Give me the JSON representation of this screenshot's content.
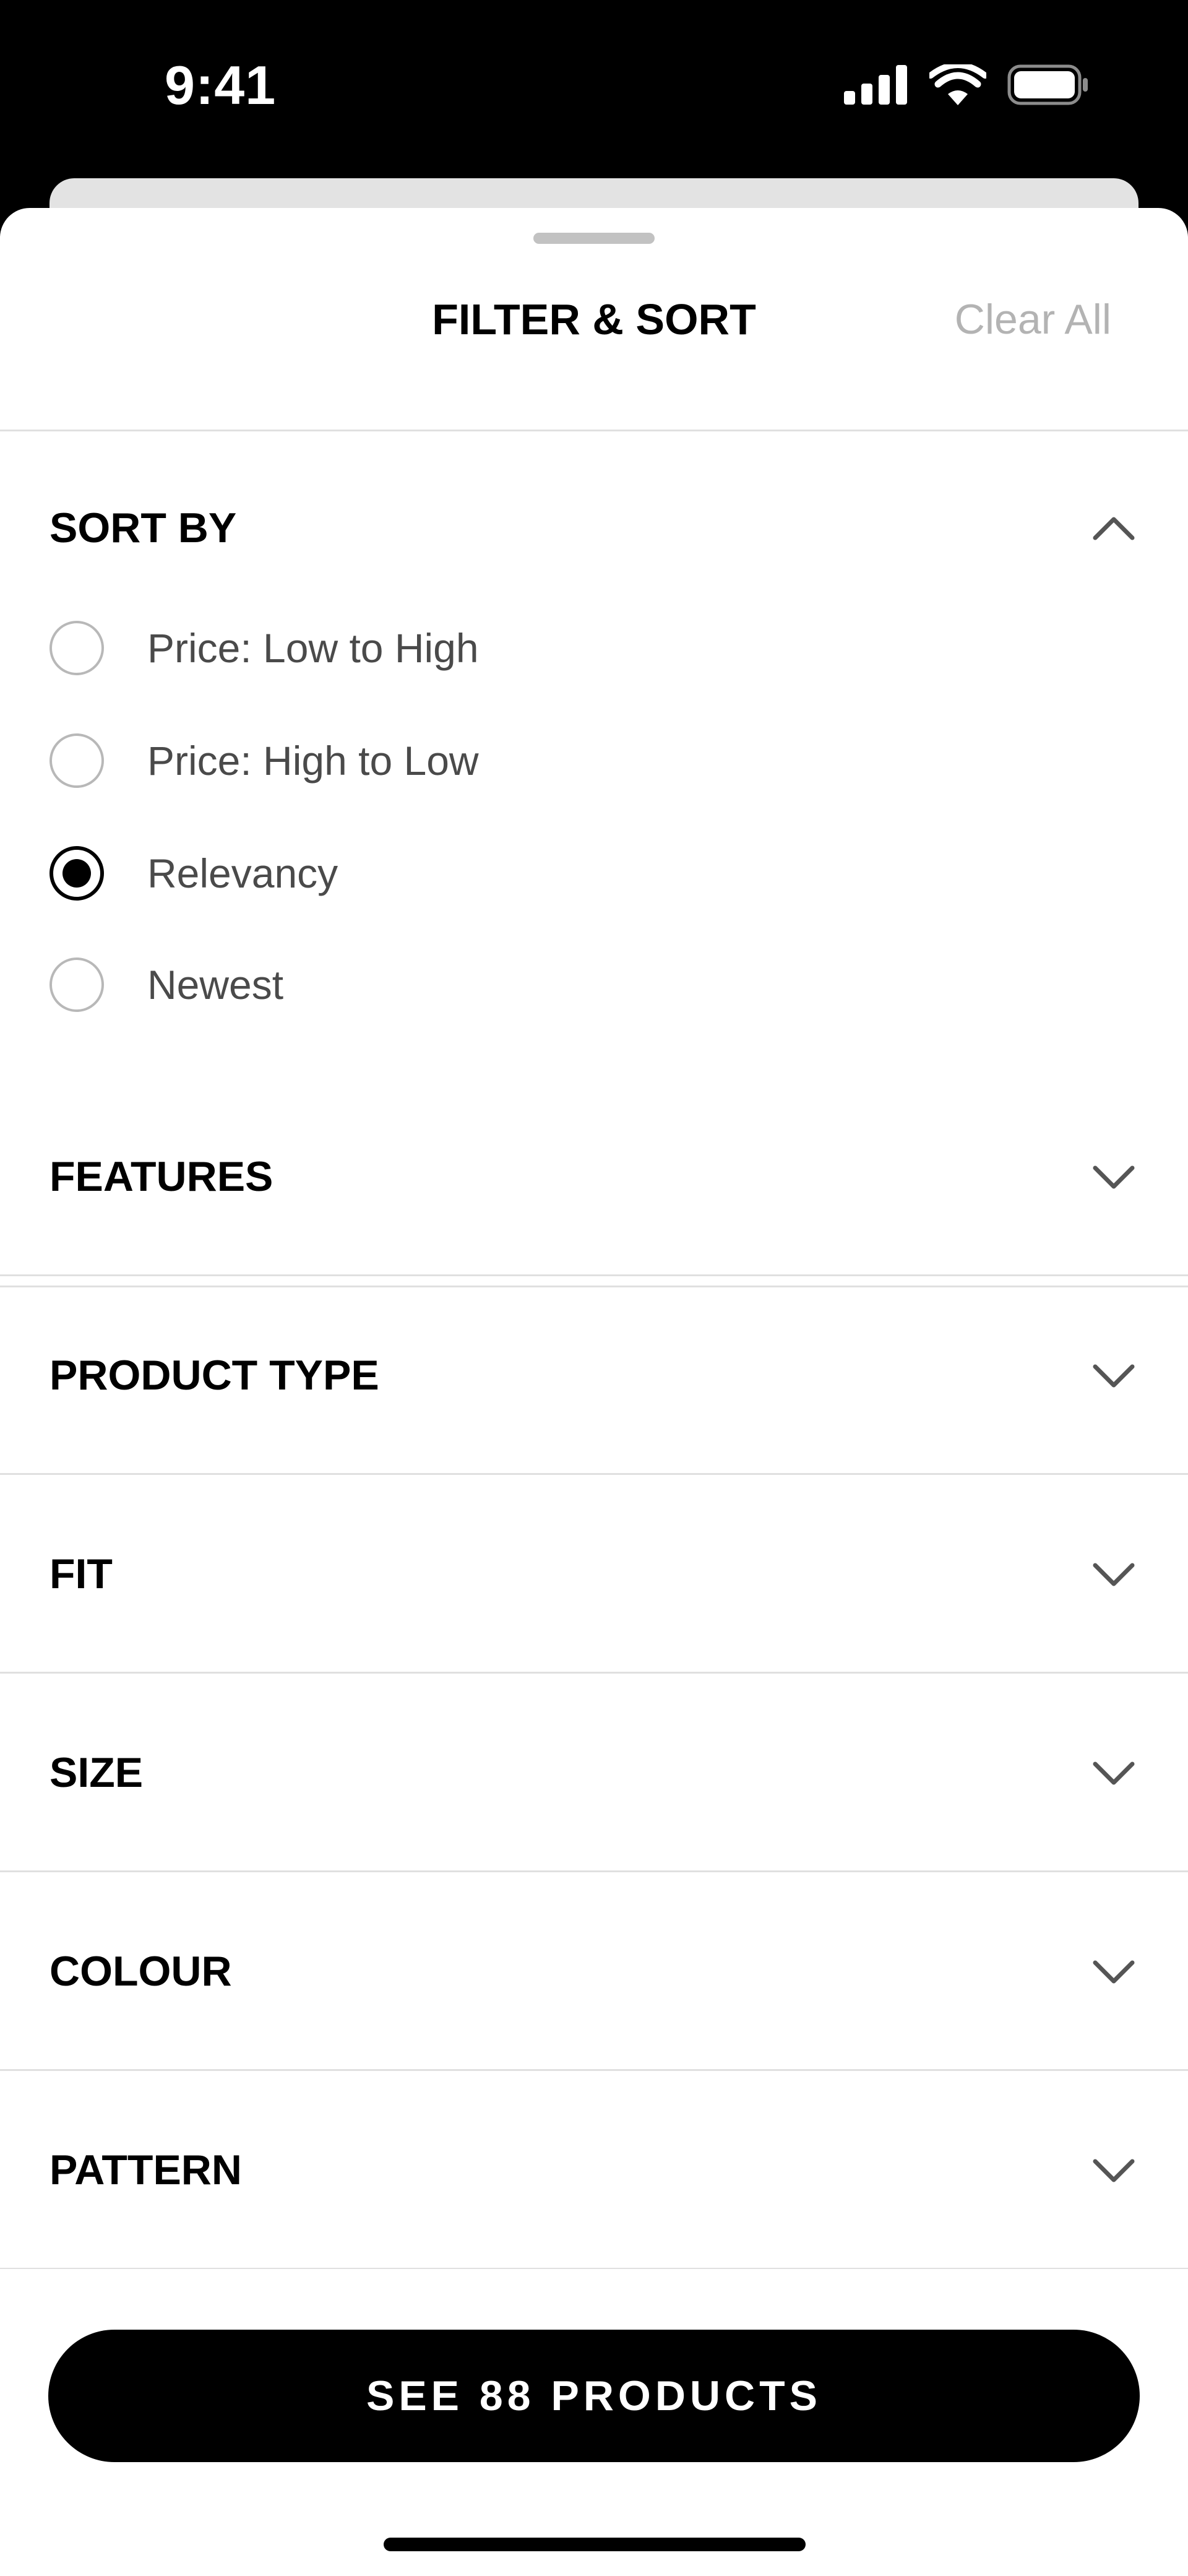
{
  "status_bar": {
    "time": "9:41",
    "icons": [
      "cellular-signal-icon",
      "wifi-icon",
      "battery-icon"
    ]
  },
  "sheet": {
    "title": "FILTER & SORT",
    "clear_all_label": "Clear All"
  },
  "sort_by": {
    "title": "SORT BY",
    "expanded": true,
    "options": [
      {
        "label": "Price: Low to High",
        "selected": false
      },
      {
        "label": "Price: High to Low",
        "selected": false
      },
      {
        "label": "Relevancy",
        "selected": true
      },
      {
        "label": "Newest",
        "selected": false
      }
    ]
  },
  "filters": [
    {
      "title": "FEATURES",
      "expanded": false
    },
    {
      "title": "PRODUCT TYPE",
      "expanded": false
    },
    {
      "title": "FIT",
      "expanded": false
    },
    {
      "title": "SIZE",
      "expanded": false
    },
    {
      "title": "COLOUR",
      "expanded": false
    },
    {
      "title": "PATTERN",
      "expanded": false
    }
  ],
  "footer": {
    "cta_label": "SEE 88 PRODUCTS"
  },
  "colors": {
    "background": "#000000",
    "sheet": "#ffffff",
    "accent": "#000000",
    "muted_text": "#b3b3b3",
    "divider": "#e0e0e0"
  }
}
